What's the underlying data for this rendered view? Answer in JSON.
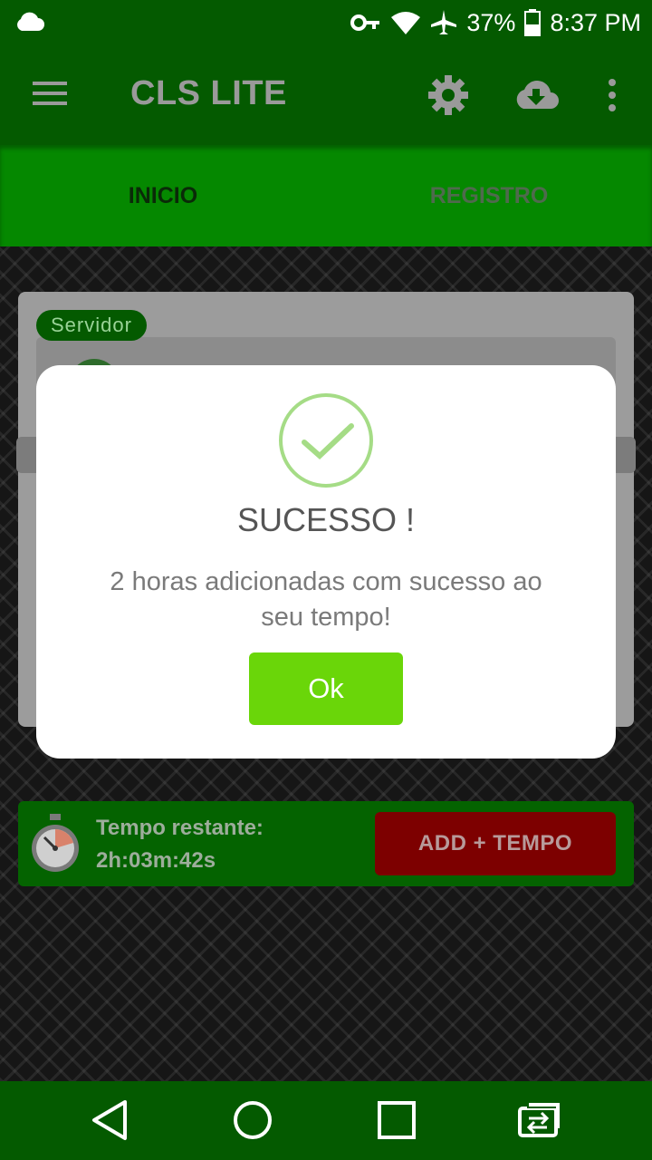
{
  "status_bar": {
    "battery": "37%",
    "time": "8:37 PM"
  },
  "app_bar": {
    "title": "CLS LITE"
  },
  "tabs": [
    {
      "label": "INICIO"
    },
    {
      "label": "REGISTRO"
    }
  ],
  "card": {
    "server_label": "Servidor"
  },
  "timer": {
    "label": "Tempo restante:",
    "value": "2h:03m:42s",
    "add_button": "ADD + TEMPO"
  },
  "dialog": {
    "heading": "SUCESSO !",
    "message": "2 horas adicionadas com sucesso ao seu tempo!",
    "ok_button": "Ok"
  },
  "colors": {
    "primary": "#045a00",
    "tab_bar": "#058800",
    "ok_button": "#6ad609",
    "add_button": "#7d0000",
    "check": "#a5dc86"
  }
}
